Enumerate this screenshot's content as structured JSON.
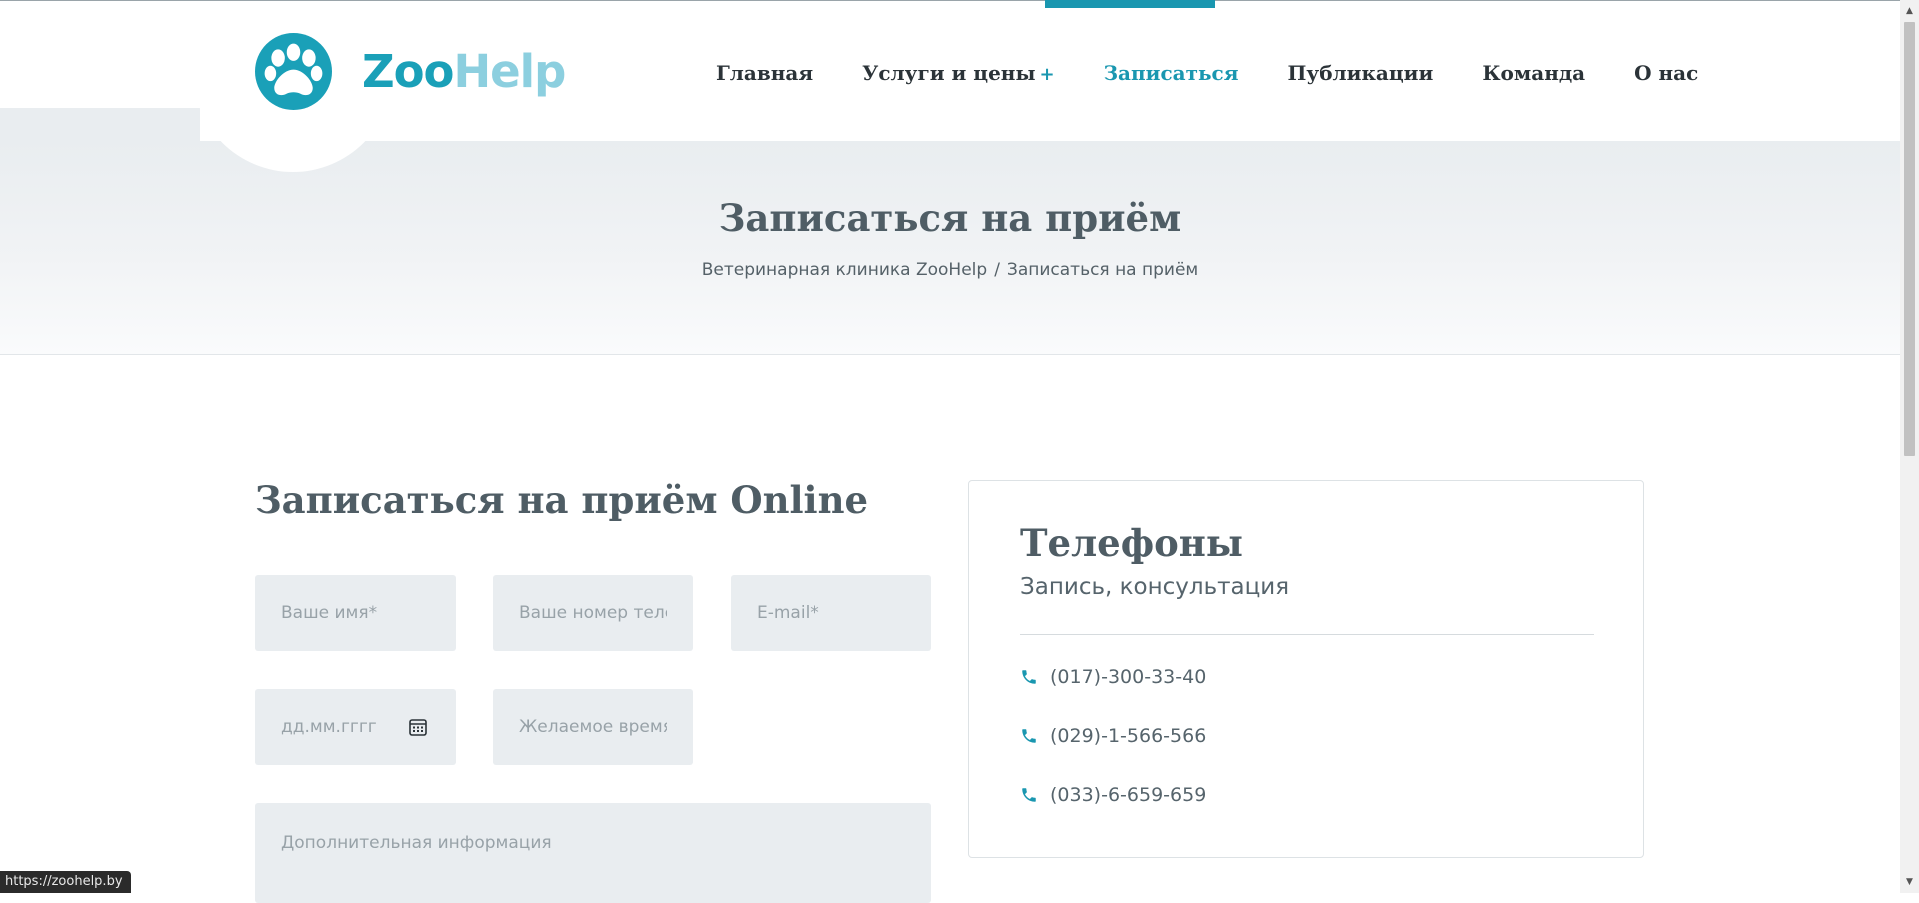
{
  "logo": {
    "part1": "Zoo",
    "part2": "Help",
    "brand_color": "#1aa0b8",
    "accent_light": "#8ccfdf"
  },
  "nav": {
    "items": [
      {
        "label": "Главная"
      },
      {
        "label": "Услуги и цены",
        "plus": "+"
      },
      {
        "label": "Записаться",
        "active": true
      },
      {
        "label": "Публикации"
      },
      {
        "label": "Команда"
      },
      {
        "label": "О нас"
      }
    ]
  },
  "hero": {
    "title": "Записаться на приём",
    "breadcrumb": {
      "home": "Ветеринарная клиника ZooHelp",
      "sep": "/",
      "current": "Записаться на приём"
    }
  },
  "form": {
    "title": "Записаться на приём Online",
    "name_placeholder": "Ваше имя*",
    "phone_placeholder": "Ваше номер телефона*",
    "email_placeholder": "E-mail*",
    "date_placeholder": "дд.мм.гггг",
    "time_placeholder": "Желаемое время",
    "info_placeholder": "Дополнительная информация"
  },
  "contacts": {
    "title": "Телефоны",
    "subtitle": "Запись, консультация",
    "phones": [
      "(017)-300-33-40",
      "(029)-1-566-566",
      "(033)-6-659-659"
    ],
    "icon": "phone-icon"
  },
  "status": {
    "url": "https://zoohelp.by"
  },
  "colors": {
    "accent": "#1a97b0",
    "text_dark": "#2b3338",
    "heading": "#4f5d65",
    "field_bg": "#e9edf0"
  }
}
